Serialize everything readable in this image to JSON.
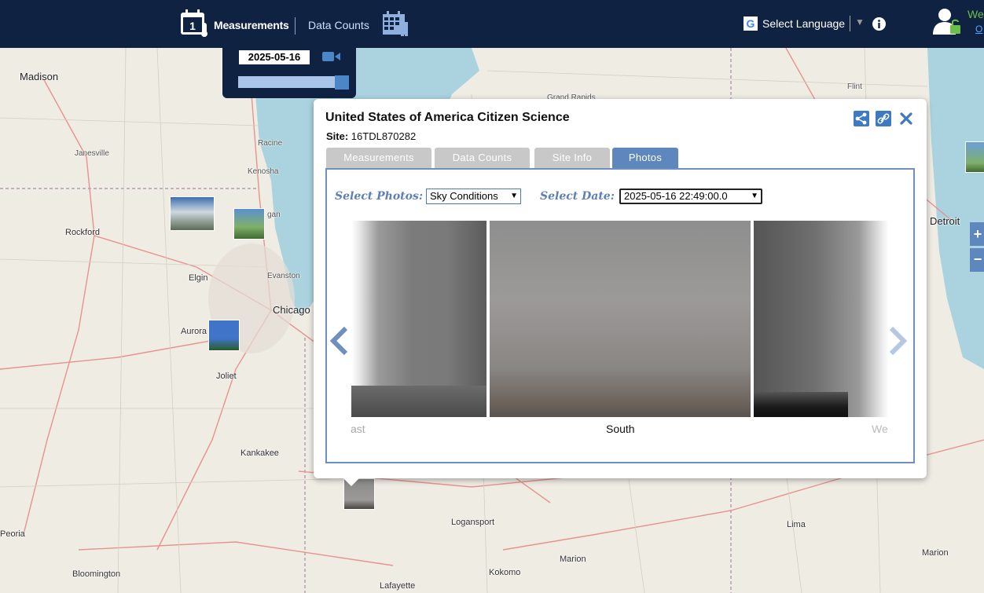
{
  "header": {
    "measurements_label": "Measurements",
    "measurements_icon_day": "1",
    "data_counts_label": "Data Counts",
    "language_label": "Select Language",
    "language_arrow": "▼",
    "welcome_text": "We",
    "welcome_sub": "O"
  },
  "date_panel": {
    "date": "2025-05-16",
    "slider_fraction": 1.0
  },
  "popup": {
    "title": "United States of America Citizen Science",
    "site_label": "Site:",
    "site_value": "16TDL870282",
    "tabs": [
      {
        "label": "Measurements"
      },
      {
        "label": "Data Counts"
      },
      {
        "label": "Site Info"
      },
      {
        "label": "Photos",
        "active": true
      }
    ],
    "select_photos_label": "Select Photos:",
    "select_photos_value": "Sky Conditions",
    "select_date_label": "Select Date:",
    "select_date_value": "2025-05-16 22:49:00.0",
    "photos": [
      {
        "caption": "ast"
      },
      {
        "caption": "South"
      },
      {
        "caption": "We"
      }
    ]
  },
  "map": {
    "zoom_in": "+",
    "zoom_out": "−",
    "cities": [
      {
        "id": "madison",
        "name": "Madison"
      },
      {
        "id": "janesville",
        "name": "Janesville"
      },
      {
        "id": "rockford",
        "name": "Rockford"
      },
      {
        "id": "racine",
        "name": "Racine"
      },
      {
        "id": "kenosha",
        "name": "Kenosha"
      },
      {
        "id": "waukegan",
        "name": "gan"
      },
      {
        "id": "elgin",
        "name": "Elgin"
      },
      {
        "id": "evanston",
        "name": "Evanston"
      },
      {
        "id": "chicago",
        "name": "Chicago"
      },
      {
        "id": "aurora",
        "name": "Aurora"
      },
      {
        "id": "joliet",
        "name": "Joliet"
      },
      {
        "id": "kankakee",
        "name": "Kankakee"
      },
      {
        "id": "peoria",
        "name": "Peoria"
      },
      {
        "id": "bloomington",
        "name": "Bloomington"
      },
      {
        "id": "logansport",
        "name": "Logansport"
      },
      {
        "id": "marion",
        "name": "Marion"
      },
      {
        "id": "kokomo",
        "name": "Kokomo"
      },
      {
        "id": "lafayette",
        "name": "Lafayette"
      },
      {
        "id": "lima",
        "name": "Lima"
      },
      {
        "id": "marion_oh",
        "name": "Marion"
      },
      {
        "id": "flint",
        "name": "Flint"
      },
      {
        "id": "detroit",
        "name": "Detroit"
      },
      {
        "id": "grand_rapids",
        "name": "Grand Rapids"
      }
    ]
  }
}
